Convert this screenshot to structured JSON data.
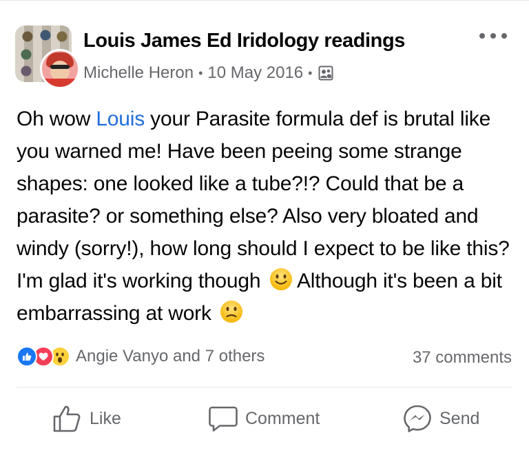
{
  "post": {
    "group_name": "Louis James Ed Iridology readings",
    "author": "Michelle Heron",
    "date": "10 May 2016",
    "separator": "•",
    "audience_icon": "group-members-icon",
    "text_before_mention": "Oh wow ",
    "mention": "Louis",
    "text_after_mention": " your Parasite formula def is brutal like you warned me! Have been peeing some strange shapes: one looked like a tube?!? Could that be a parasite? or something else? Also very bloated and windy (sorry!), how long should I expect to be like this? I'm glad it's working though ",
    "text_line_last": " Although it's been a bit embarrassing at work ",
    "emoji_1": "slightly-smiling-face",
    "emoji_2": "confused-face"
  },
  "reactions": {
    "types": [
      "like-icon",
      "love-icon",
      "wow-icon"
    ],
    "summary": "Angie Vanyo and 7 others",
    "comments": "37 comments"
  },
  "actions": {
    "like": "Like",
    "comment": "Comment",
    "send": "Send"
  },
  "colors": {
    "mention": "#216fdb",
    "secondary_text": "#65676b",
    "like_blue": "#1877f2",
    "love_red": "#f33e58",
    "wow_yellow": "#fcd13b"
  }
}
